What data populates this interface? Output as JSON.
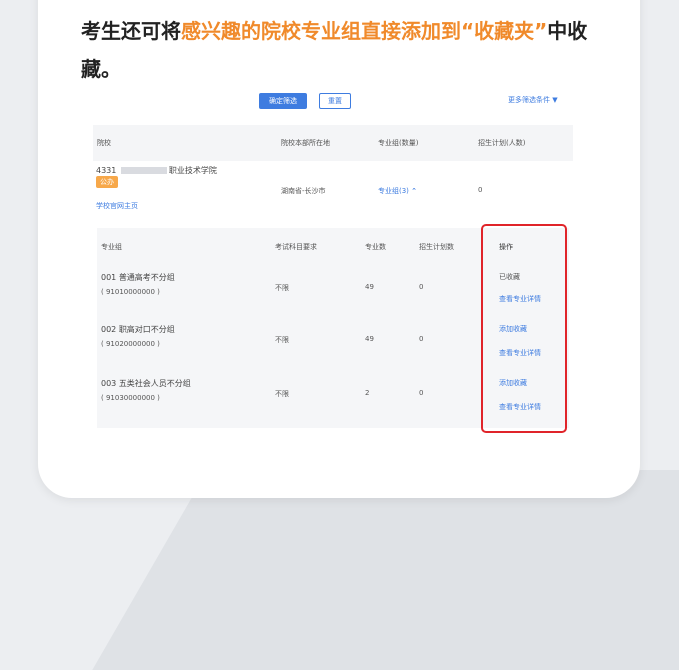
{
  "headline": {
    "pre": "考生还可将",
    "highlight": "感兴趣的院校专业组直接添加到“收藏夹”",
    "post": "中收藏。"
  },
  "toolbar": {
    "confirm_label": "确定筛选",
    "reset_label": "重置",
    "more_label": "更多筛选条件"
  },
  "table": {
    "headers": [
      "院校",
      "院校本部所在地",
      "专业组(数量)",
      "招生计划(人数)"
    ],
    "school": {
      "code": "4331",
      "name_suffix": "职业技术学院",
      "tag": "公办",
      "homepage_link": "学校官网主页",
      "location": "湖南省-长沙市",
      "groups_link": "专业组(3)",
      "plan": "0"
    }
  },
  "subtable": {
    "headers": [
      "专业组",
      "考试科目要求",
      "专业数",
      "招生计划数",
      "操作"
    ],
    "rows": [
      {
        "name": "001 普通高考不分组",
        "code": "( 91010000000 )",
        "req": "不限",
        "count": "49",
        "plan": "0",
        "action1": "已收藏",
        "action2": "查看专业详情"
      },
      {
        "name": "002 职高对口不分组",
        "code": "( 91020000000 )",
        "req": "不限",
        "count": "49",
        "plan": "0",
        "action1": "添加收藏",
        "action2": "查看专业详情"
      },
      {
        "name": "003 五类社会人员不分组",
        "code": "( 91030000000 )",
        "req": "不限",
        "count": "2",
        "plan": "0",
        "action1": "添加收藏",
        "action2": "查看专业详情"
      }
    ]
  },
  "colors": {
    "accent": "#3e7ce0",
    "highlight": "#f08a2b",
    "redbox": "#e0242a"
  }
}
